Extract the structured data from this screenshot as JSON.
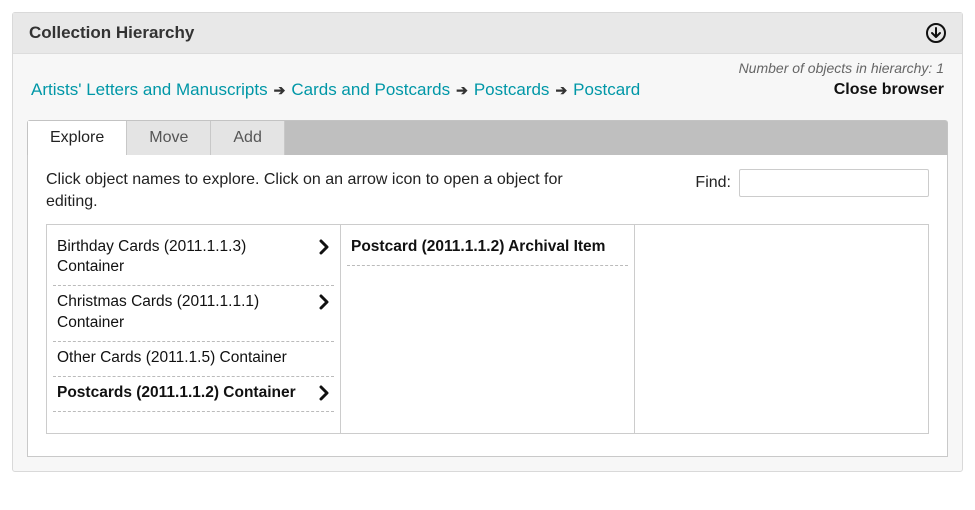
{
  "header": {
    "title": "Collection Hierarchy"
  },
  "meta": {
    "count_label": "Number of objects in hierarchy: 1"
  },
  "breadcrumbs": [
    "Artists' Letters and Manuscripts",
    "Cards and Postcards",
    "Postcards",
    "Postcard"
  ],
  "close_label": "Close browser",
  "tabs": {
    "explore": "Explore",
    "move": "Move",
    "add": "Add"
  },
  "instructions": "Click object names to explore. Click on an arrow icon to open a object for editing.",
  "find": {
    "label": "Find:",
    "value": ""
  },
  "columns": {
    "col1": [
      {
        "label": "Birthday Cards (2011.1.1.3) Container",
        "has_children": true,
        "selected": false
      },
      {
        "label": "Christmas Cards (2011.1.1.1) Container",
        "has_children": true,
        "selected": false
      },
      {
        "label": "Other Cards (2011.1.5) Container",
        "has_children": false,
        "selected": false
      },
      {
        "label": "Postcards (2011.1.1.2) Container",
        "has_children": true,
        "selected": true
      }
    ],
    "col2": [
      {
        "label": "Postcard (2011.1.1.2) Archival Item",
        "has_children": false,
        "selected": true
      }
    ]
  }
}
